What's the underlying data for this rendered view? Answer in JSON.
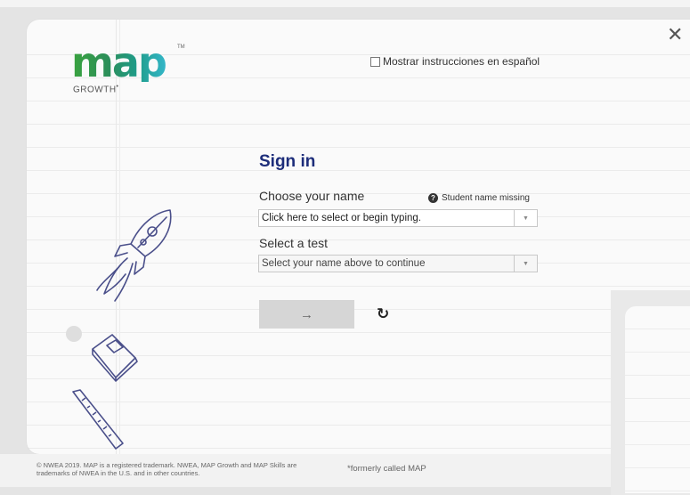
{
  "window": {
    "close_icon": "close-icon",
    "close_glyph": "✕"
  },
  "logo": {
    "word": "map",
    "tm": "TM",
    "sub": "GROWTH",
    "sub_mark": "•"
  },
  "language_toggle": {
    "label": "Mostrar instrucciones en español",
    "checked": false
  },
  "signin": {
    "title": "Sign in",
    "name_label": "Choose your name",
    "name_missing": "Student name missing",
    "name_placeholder": "Click here to select or begin typing.",
    "test_label": "Select a test",
    "test_placeholder": "Select your name above to continue",
    "submit_glyph": "→",
    "refresh_glyph": "↻"
  },
  "footer": {
    "copyright": "© NWEA 2019. MAP is a registered trademark. NWEA, MAP Growth and MAP Skills are trademarks of NWEA in the U.S. and in other countries.",
    "formerly": "*formerly called MAP"
  }
}
